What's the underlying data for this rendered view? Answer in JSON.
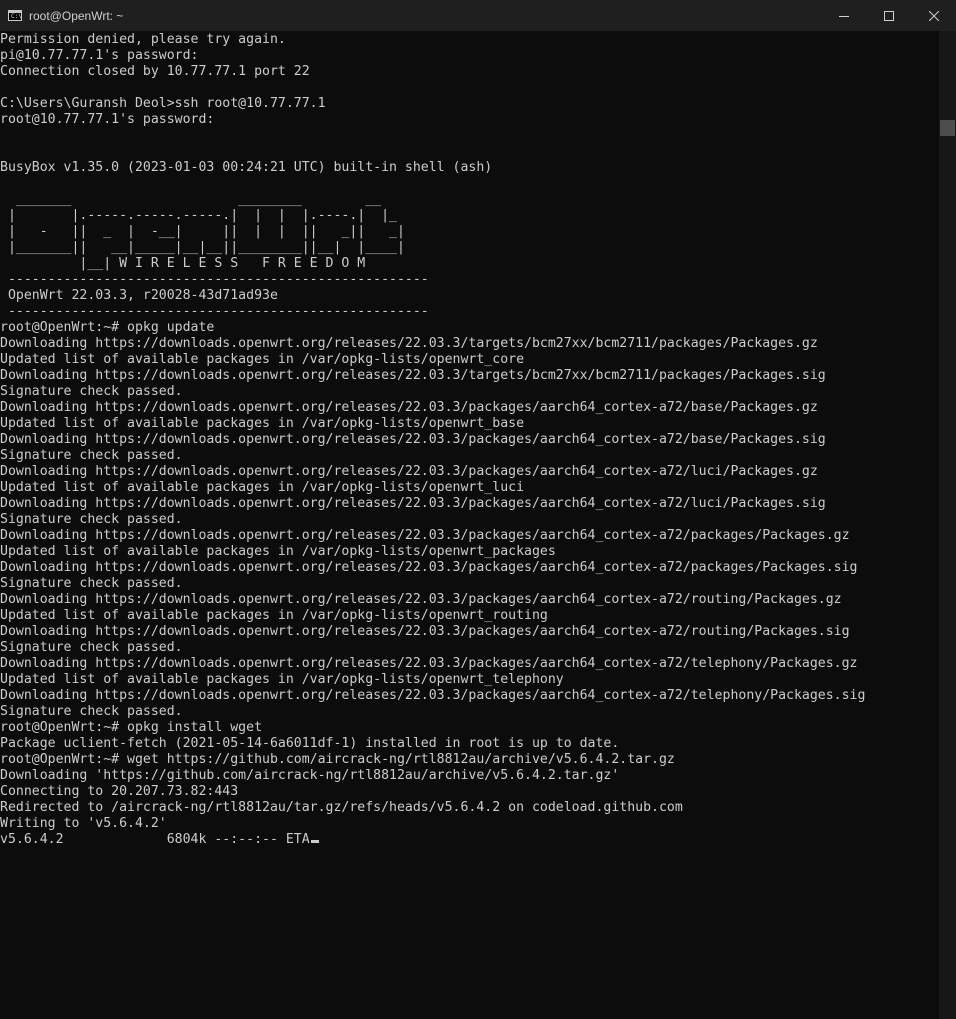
{
  "window": {
    "title": "root@OpenWrt: ~",
    "app_icon_text": "C:\\",
    "controls": [
      "minimize",
      "maximize",
      "close"
    ]
  },
  "terminal": {
    "foreground": "#cccccc",
    "background": "#0c0c0c",
    "lines": [
      "Permission denied, please try again.",
      "pi@10.77.77.1's password:",
      "Connection closed by 10.77.77.1 port 22",
      "",
      "C:\\Users\\Guransh Deol>ssh root@10.77.77.1",
      "root@10.77.77.1's password:",
      "",
      "",
      "BusyBox v1.35.0 (2023-01-03 00:24:21 UTC) built-in shell (ash)",
      "",
      "  _______                     ________        __",
      " |       |.-----.-----.-----.|  |  |  |.----.|  |_",
      " |   -   ||  _  |  -__|     ||  |  |  ||   _||   _|",
      " |_______||   __|_____|__|__||________||__|  |____|",
      "          |__| W I R E L E S S   F R E E D O M",
      " -----------------------------------------------------",
      " OpenWrt 22.03.3, r20028-43d71ad93e",
      " -----------------------------------------------------",
      "root@OpenWrt:~# opkg update",
      "Downloading https://downloads.openwrt.org/releases/22.03.3/targets/bcm27xx/bcm2711/packages/Packages.gz",
      "Updated list of available packages in /var/opkg-lists/openwrt_core",
      "Downloading https://downloads.openwrt.org/releases/22.03.3/targets/bcm27xx/bcm2711/packages/Packages.sig",
      "Signature check passed.",
      "Downloading https://downloads.openwrt.org/releases/22.03.3/packages/aarch64_cortex-a72/base/Packages.gz",
      "Updated list of available packages in /var/opkg-lists/openwrt_base",
      "Downloading https://downloads.openwrt.org/releases/22.03.3/packages/aarch64_cortex-a72/base/Packages.sig",
      "Signature check passed.",
      "Downloading https://downloads.openwrt.org/releases/22.03.3/packages/aarch64_cortex-a72/luci/Packages.gz",
      "Updated list of available packages in /var/opkg-lists/openwrt_luci",
      "Downloading https://downloads.openwrt.org/releases/22.03.3/packages/aarch64_cortex-a72/luci/Packages.sig",
      "Signature check passed.",
      "Downloading https://downloads.openwrt.org/releases/22.03.3/packages/aarch64_cortex-a72/packages/Packages.gz",
      "Updated list of available packages in /var/opkg-lists/openwrt_packages",
      "Downloading https://downloads.openwrt.org/releases/22.03.3/packages/aarch64_cortex-a72/packages/Packages.sig",
      "Signature check passed.",
      "Downloading https://downloads.openwrt.org/releases/22.03.3/packages/aarch64_cortex-a72/routing/Packages.gz",
      "Updated list of available packages in /var/opkg-lists/openwrt_routing",
      "Downloading https://downloads.openwrt.org/releases/22.03.3/packages/aarch64_cortex-a72/routing/Packages.sig",
      "Signature check passed.",
      "Downloading https://downloads.openwrt.org/releases/22.03.3/packages/aarch64_cortex-a72/telephony/Packages.gz",
      "Updated list of available packages in /var/opkg-lists/openwrt_telephony",
      "Downloading https://downloads.openwrt.org/releases/22.03.3/packages/aarch64_cortex-a72/telephony/Packages.sig",
      "Signature check passed.",
      "root@OpenWrt:~# opkg install wget",
      "Package uclient-fetch (2021-05-14-6a6011df-1) installed in root is up to date.",
      "root@OpenWrt:~# wget https://github.com/aircrack-ng/rtl8812au/archive/v5.6.4.2.tar.gz",
      "Downloading 'https://github.com/aircrack-ng/rtl8812au/archive/v5.6.4.2.tar.gz'",
      "Connecting to 20.207.73.82:443",
      "Redirected to /aircrack-ng/rtl8812au/tar.gz/refs/heads/v5.6.4.2 on codeload.github.com",
      "Writing to 'v5.6.4.2'"
    ],
    "progress_line": "v5.6.4.2             6804k --:--:-- ETA"
  }
}
